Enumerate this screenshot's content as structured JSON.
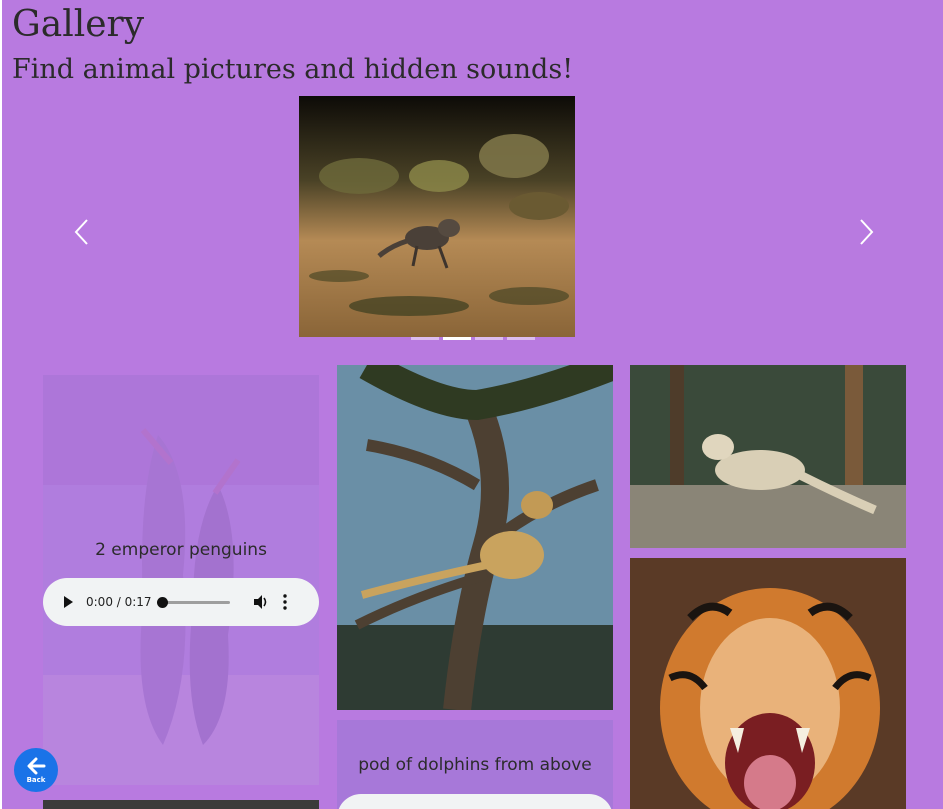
{
  "header": {
    "title": "Gallery",
    "subtitle": "Find animal pictures and hidden sounds!"
  },
  "carousel": {
    "prev_icon": "chevron-left-icon",
    "next_icon": "chevron-right-icon",
    "slide_count": 4,
    "active_index": 1,
    "current_image": "axolotl walking on sand"
  },
  "gallery": [
    {
      "image": "two emperor penguins",
      "caption": "2 emperor penguins",
      "audio": {
        "time": "0:00 / 0:17"
      }
    },
    {
      "image": "cheetah in tree"
    },
    {
      "image": "snow leopard on rock"
    },
    {
      "image": "tiger roaring"
    },
    {
      "image": "dolphins",
      "caption": "pod of dolphins from above"
    }
  ],
  "back_button": {
    "label": "Back",
    "icon": "arrow-left-icon"
  },
  "colors": {
    "background": "#b87ae0",
    "back_button": "#1a73e8",
    "audio_bg": "#f1f3f4"
  }
}
